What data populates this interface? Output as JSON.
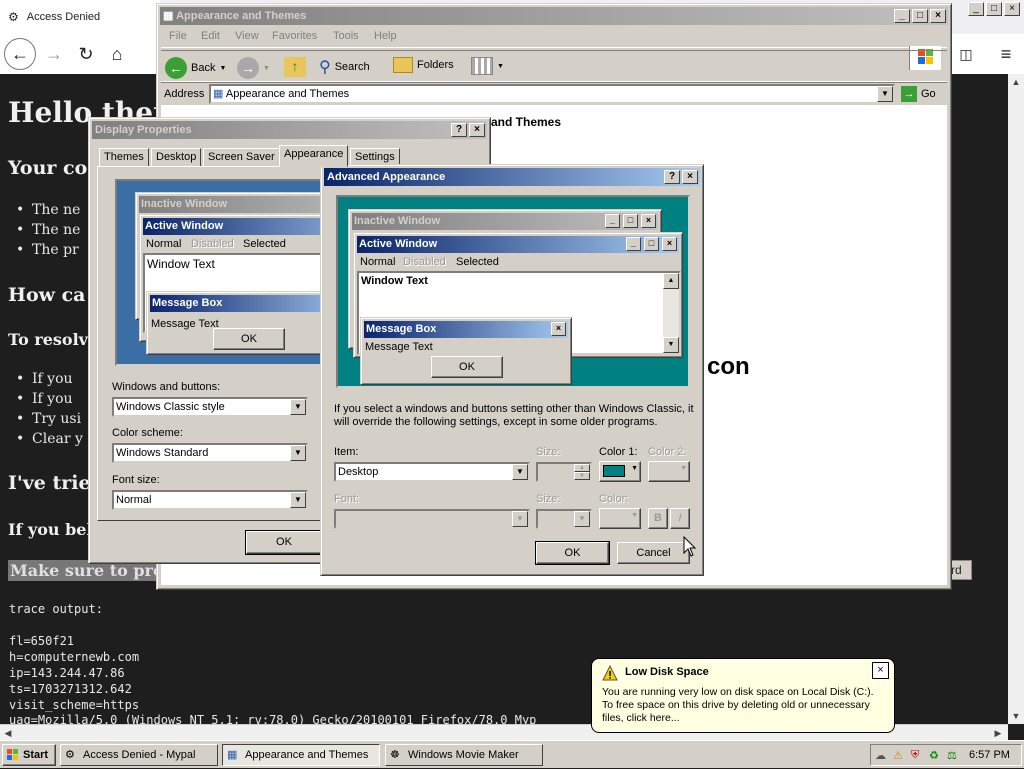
{
  "browser": {
    "tab_title": "Access Denied",
    "heading": "Hello there",
    "sub1": "Your co",
    "bullets1": [
      "The ne",
      "The ne",
      "The pr"
    ],
    "sub2": "How ca",
    "sub3": "To resolve",
    "bullets2": [
      "If you",
      "If you",
      "Try usi",
      "Clear y"
    ],
    "sub4": "I've trie",
    "sub5": "If you beli",
    "highlight": "Make sure to prov",
    "partial_right": "con",
    "leftover_btn": "rd",
    "trace_label": "trace output:",
    "trace": [
      "fl=650f21",
      "h=computernewb.com",
      "ip=143.244.47.86",
      "ts=1703271312.642",
      "visit_scheme=https",
      "uag=Mozilla/5.0 (Windows NT 5.1; rv:78.0) Gecko/20100101 Firefox/78.0 Myp"
    ]
  },
  "explorer": {
    "title": "Appearance and Themes",
    "menu": [
      "File",
      "Edit",
      "View",
      "Favorites",
      "Tools",
      "Help"
    ],
    "toolbar": {
      "back": "Back",
      "search": "Search",
      "folders": "Folders"
    },
    "address_label": "Address",
    "address_value": "Appearance and Themes",
    "go": "Go",
    "content_heading": "and Themes"
  },
  "display_properties": {
    "title": "Display Properties",
    "tabs": [
      "Themes",
      "Desktop",
      "Screen Saver",
      "Appearance",
      "Settings"
    ],
    "selected_tab": "Appearance",
    "preview": {
      "inactive": "Inactive Window",
      "active": "Active Window",
      "menu": [
        "Normal",
        "Disabled",
        "Selected"
      ],
      "window_text": "Window Text",
      "msgbox_title": "Message Box",
      "msgbox_text": "Message Text",
      "ok": "OK"
    },
    "windows_buttons_label": "Windows and buttons:",
    "windows_buttons_value": "Windows Classic style",
    "color_scheme_label": "Color scheme:",
    "color_scheme_value": "Windows Standard",
    "font_size_label": "Font size:",
    "font_size_value": "Normal",
    "ok": "OK"
  },
  "advanced_appearance": {
    "title": "Advanced Appearance",
    "preview": {
      "inactive": "Inactive Window",
      "active": "Active Window",
      "menu": [
        "Normal",
        "Disabled",
        "Selected"
      ],
      "window_text": "Window Text",
      "msgbox_title": "Message Box",
      "msgbox_text": "Message Text",
      "ok": "OK"
    },
    "info_text": "If you select a windows and buttons setting other than Windows Classic, it will override the following settings, except in some older programs.",
    "item_label": "Item:",
    "item_value": "Desktop",
    "size_label": "Size:",
    "color1_label": "Color 1:",
    "color2_label": "Color 2:",
    "font_label": "Font:",
    "font_size_label": "Size:",
    "font_color_label": "Color:",
    "bold": "B",
    "italic": "I",
    "ok": "OK",
    "cancel": "Cancel",
    "desktop_color": "#008080"
  },
  "balloon": {
    "title": "Low Disk Space",
    "body": "You are running very low on disk space on Local Disk (C:). To free space on this drive by deleting old or unnecessary files, click here..."
  },
  "taskbar": {
    "start": "Start",
    "tasks": [
      "Access Denied - Mypal",
      "Appearance and Themes",
      "Windows Movie Maker"
    ],
    "clock": "6:57 PM"
  },
  "colors": {
    "titlebar_active_start": "#0a246a",
    "titlebar_active_end": "#a6caf0",
    "desktop_teal": "#008080",
    "preview_blue": "#3a6ea5",
    "balloon_bg": "#ffffe1"
  }
}
